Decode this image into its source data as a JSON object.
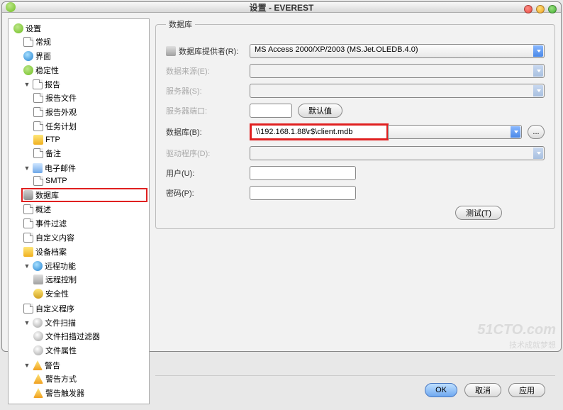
{
  "window": {
    "title": "设置 - EVEREST"
  },
  "tree": {
    "root": "设置",
    "items": {
      "general": "常规",
      "ui": "界面",
      "stability": "稳定性",
      "report": "报告",
      "report_file": "报告文件",
      "report_look": "报告外观",
      "task": "任务计划",
      "ftp": "FTP",
      "notes": "备注",
      "email": "电子邮件",
      "smtp": "SMTP",
      "database": "数据库",
      "summary": "概述",
      "filter": "事件过滤",
      "custom": "自定义内容",
      "archive": "设备档案",
      "remote": "远程功能",
      "remote_ctrl": "远程控制",
      "security": "安全性",
      "custom_prog": "自定义程序",
      "filescan": "文件扫描",
      "scan_filter": "文件扫描过滤器",
      "file_attr": "文件属性",
      "alerts": "警告",
      "alert_mode": "警告方式",
      "alert_trigger": "警告触发器"
    }
  },
  "form": {
    "legend": "数据库",
    "provider_label": "数据库提供者(R):",
    "provider_value": "MS Access 2000/XP/2003 (MS.Jet.OLEDB.4.0)",
    "datasource_label": "数据来源(E):",
    "server_label": "服务器(S):",
    "port_label": "服务器端口:",
    "default_btn": "默认值",
    "db_label": "数据库(B):",
    "db_value": "\\\\192.168.1.88\\r$\\client.mdb",
    "driver_label": "驱动程序(D):",
    "user_label": "用户(U):",
    "pass_label": "密码(P):",
    "test_btn": "测试(T)",
    "browse_btn": "..."
  },
  "footer": {
    "ok": "OK",
    "cancel": "取消",
    "apply": "应用"
  },
  "watermark": {
    "main": "51CTO.com",
    "sub": "技术成就梦想"
  }
}
